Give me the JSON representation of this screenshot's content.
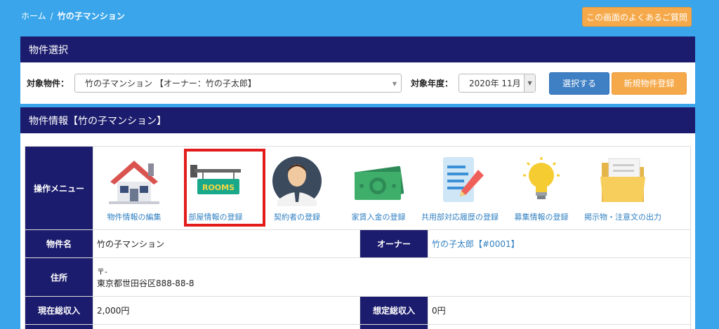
{
  "breadcrumb": {
    "home": "ホーム",
    "separator": "/",
    "current": "竹の子マンション"
  },
  "faq_button": "この画面のよくあるご質問",
  "select_panel": {
    "title": "物件選択",
    "property_label": "対象物件：",
    "property_value": "竹の子マンション 【オーナー：竹の子太郎】",
    "year_label": "対象年度：",
    "year_value": "2020年 11月",
    "select_button": "選択する",
    "new_button": "新規物件登録"
  },
  "info_panel": {
    "title": "物件情報【竹の子マンション】",
    "menu_header": "操作メニュー",
    "menu_items": [
      {
        "label": "物件情報の編集",
        "icon": "house-icon"
      },
      {
        "label": "部屋情報の登録",
        "icon": "rooms-sign-icon"
      },
      {
        "label": "契約者の登録",
        "icon": "person-icon"
      },
      {
        "label": "家賃入金の登録",
        "icon": "money-icon"
      },
      {
        "label": "共用部対応履歴の登録",
        "icon": "document-pen-icon"
      },
      {
        "label": "募集情報の登録",
        "icon": "lightbulb-icon"
      },
      {
        "label": "掲示物・注意文の出力",
        "icon": "folder-icon"
      }
    ],
    "rows": {
      "name_label": "物件名",
      "name_value": "竹の子マンション",
      "owner_label": "オーナー",
      "owner_value": "竹の子太郎【#0001】",
      "address_label": "住所",
      "postal_mark": "〒-",
      "address_value": "東京都世田谷区888-88-8",
      "current_income_label": "現在総収入",
      "current_income_value": "2,000円",
      "expected_income_label": "想定総収入",
      "expected_income_value": "0円"
    }
  },
  "colors": {
    "background": "#3aa5ea",
    "header": "#1c1c6e",
    "accent": "#f5a94a",
    "primary": "#3f7fc4",
    "highlight": "#e21b1b"
  }
}
